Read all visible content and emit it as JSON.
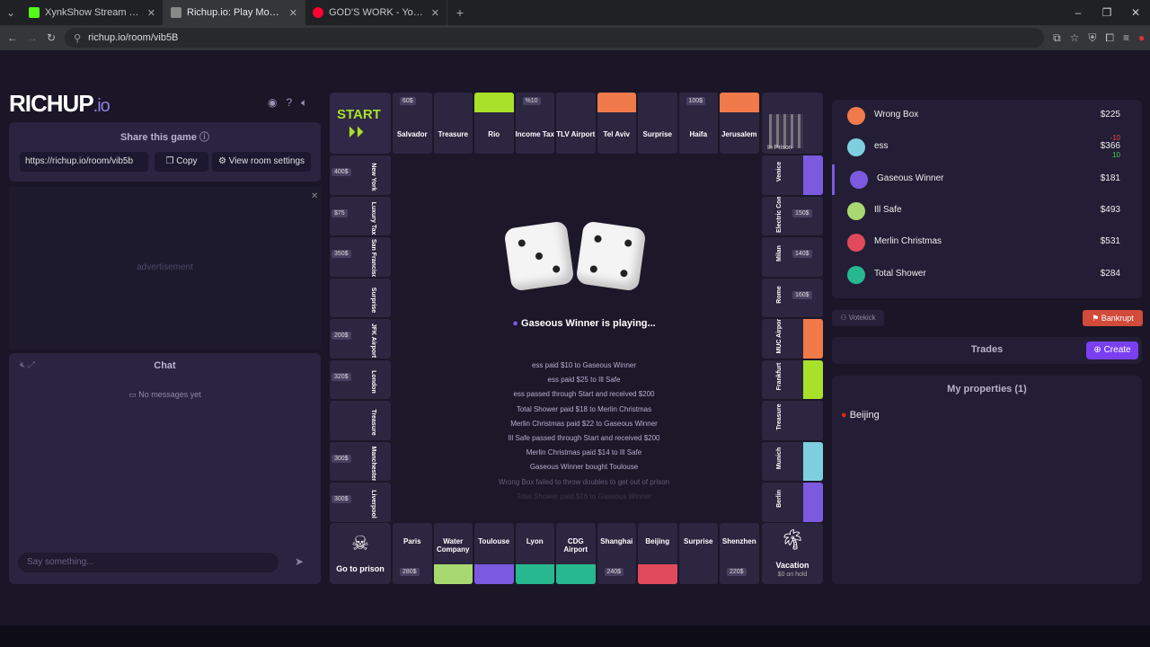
{
  "browser": {
    "tabs": [
      {
        "title": "XynkShow Stream - Watch Live",
        "color": "#53fc18"
      },
      {
        "title": "Richup.io: Play Monopoly A",
        "color": "#888888"
      },
      {
        "title": "GOD'S WORK - YouTube M",
        "color": "#ff0033"
      }
    ],
    "url": "richup.io/room/vib5B"
  },
  "left": {
    "logo_main": "RICHUP",
    "logo_suffix": ".io",
    "share_title": "Share this game",
    "share_link": "https://richup.io/room/vib5b",
    "copy_label": "Copy",
    "settings_label": "View room settings",
    "ad_label": "advertisement",
    "chat_title": "Chat",
    "no_messages": "No messages yet",
    "chat_placeholder": "Say something..."
  },
  "board": {
    "start": "START",
    "go_to_prison": "Go to prison",
    "vacation": "Vacation",
    "vacation_sub": "$0 on hold",
    "in_prison": "In Prison",
    "top": [
      {
        "name": "Salvador",
        "price": "60$"
      },
      {
        "name": "Treasure",
        "price": ""
      },
      {
        "name": "Rio",
        "price": ""
      },
      {
        "name": "Income Tax",
        "price": "%10"
      },
      {
        "name": "TLV Airport",
        "price": ""
      },
      {
        "name": "Tel Aviv",
        "price": ""
      },
      {
        "name": "Surprise",
        "price": ""
      },
      {
        "name": "Haifa",
        "price": "100$"
      },
      {
        "name": "Jerusalem",
        "price": ""
      }
    ],
    "left": [
      {
        "name": "New York",
        "price": "400$"
      },
      {
        "name": "Luxury Tax",
        "price": "$75"
      },
      {
        "name": "San Francisco",
        "price": "350$"
      },
      {
        "name": "Surprise",
        "price": ""
      },
      {
        "name": "JFK Airport",
        "price": "200$"
      },
      {
        "name": "London",
        "price": "320$"
      },
      {
        "name": "Treasure",
        "price": ""
      },
      {
        "name": "Manchester",
        "price": "300$"
      },
      {
        "name": "Liverpool",
        "price": "300$"
      }
    ],
    "right": [
      {
        "name": "Venice",
        "price": ""
      },
      {
        "name": "Electric Company",
        "price": "150$"
      },
      {
        "name": "Milan",
        "price": "140$"
      },
      {
        "name": "Rome",
        "price": "160$"
      },
      {
        "name": "MUC Airport",
        "price": ""
      },
      {
        "name": "Frankfurt",
        "price": ""
      },
      {
        "name": "Treasure",
        "price": ""
      },
      {
        "name": "Munich",
        "price": ""
      },
      {
        "name": "Berlin",
        "price": ""
      }
    ],
    "bottom": [
      {
        "name": "Paris",
        "price": "280$"
      },
      {
        "name": "Water Company",
        "price": ""
      },
      {
        "name": "Toulouse",
        "price": ""
      },
      {
        "name": "Lyon",
        "price": ""
      },
      {
        "name": "CDG Airport",
        "price": ""
      },
      {
        "name": "Shanghai",
        "price": "240$"
      },
      {
        "name": "Beijing",
        "price": ""
      },
      {
        "name": "Surprise",
        "price": ""
      },
      {
        "name": "Shenzhen",
        "price": "220$"
      }
    ],
    "status": "Gaseous Winner is playing...",
    "log": [
      "ess paid $10 to Gaseous Winner",
      "ess paid $25 to Ill Safe",
      "ess passed through Start and received $200",
      "Total Shower paid $18 to Merlin Christmas",
      "Merlin Christmas paid $22 to Gaseous Winner",
      "Ill Safe passed through Start and received $200",
      "Merlin Christmas paid $14 to Ill Safe",
      "Gaseous Winner bought Toulouse",
      "Wrong Box failed to throw doubles to get out of prison",
      "Total Shower paid $16 to Gaseous Winner"
    ]
  },
  "players": [
    {
      "name": "Wrong Box",
      "money": "$225",
      "color": "#f07a4a",
      "d1": "",
      "d2": ""
    },
    {
      "name": "ess",
      "money": "$366",
      "color": "#7ed0e0",
      "d1": "-10",
      "d2": "10"
    },
    {
      "name": "Gaseous Winner",
      "money": "$181",
      "color": "#7b5ae0",
      "d1": "",
      "d2": ""
    },
    {
      "name": "Ill Safe",
      "money": "$493",
      "color": "#a8d870",
      "d1": "",
      "d2": ""
    },
    {
      "name": "Merlin Christmas",
      "money": "$531",
      "color": "#e04a5a",
      "d1": "",
      "d2": ""
    },
    {
      "name": "Total Shower",
      "money": "$284",
      "color": "#28b890",
      "d1": "",
      "d2": ""
    }
  ],
  "right": {
    "votekick": "Votekick",
    "bankrupt": "Bankrupt",
    "trades": "Trades",
    "create": "Create",
    "my_properties": "My properties (1)",
    "property": "Beijing"
  }
}
